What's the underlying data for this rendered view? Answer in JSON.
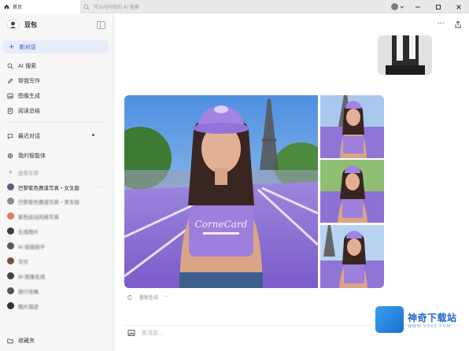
{
  "window": {
    "tab_title": "首页",
    "address_placeholder": "可以问问你的 AI 搜索",
    "controls": [
      "minimize-icon",
      "maximize-icon",
      "close-icon"
    ]
  },
  "sidebar": {
    "brand_name": "豆包",
    "new_chat_label": "新对话",
    "nav": [
      {
        "label": "AI 搜索",
        "icon": "search-icon"
      },
      {
        "label": "帮我写作",
        "icon": "pen-icon"
      },
      {
        "label": "图像生成",
        "icon": "image-icon"
      },
      {
        "label": "阅读总结",
        "icon": "book-icon"
      }
    ],
    "recent_label": "最近对话",
    "agents_label": "我的智能体",
    "chats": [
      {
        "label": "巴黎紫色赛道写真・女生版",
        "active": true
      },
      {
        "label": "巴黎紫色赛道写真・男生版",
        "active": false
      },
      {
        "label": "紫色运动风格写真",
        "active": false
      },
      {
        "label": "生成图片",
        "active": false
      },
      {
        "label": "AI 绘画助手",
        "active": false
      },
      {
        "label": "写作",
        "active": false
      },
      {
        "label": "AI 图像生成",
        "active": false
      },
      {
        "label": "旅行攻略",
        "active": false
      },
      {
        "label": "图片描述",
        "active": false
      }
    ],
    "more_label": "查看全部",
    "favorites_label": "收藏夹"
  },
  "main": {
    "image_actions": [
      "重新生成",
      "···"
    ],
    "input_placeholder": "发消息..."
  },
  "watermark": {
    "title": "神奇下载站",
    "url": "WWW.SQXZ.COM"
  },
  "colors": {
    "accent": "#2b55d9",
    "new_chat_bg": "#e8ecfa",
    "sidebar_bg": "#f7f7f8",
    "track_purple": "#8a6fd6"
  }
}
